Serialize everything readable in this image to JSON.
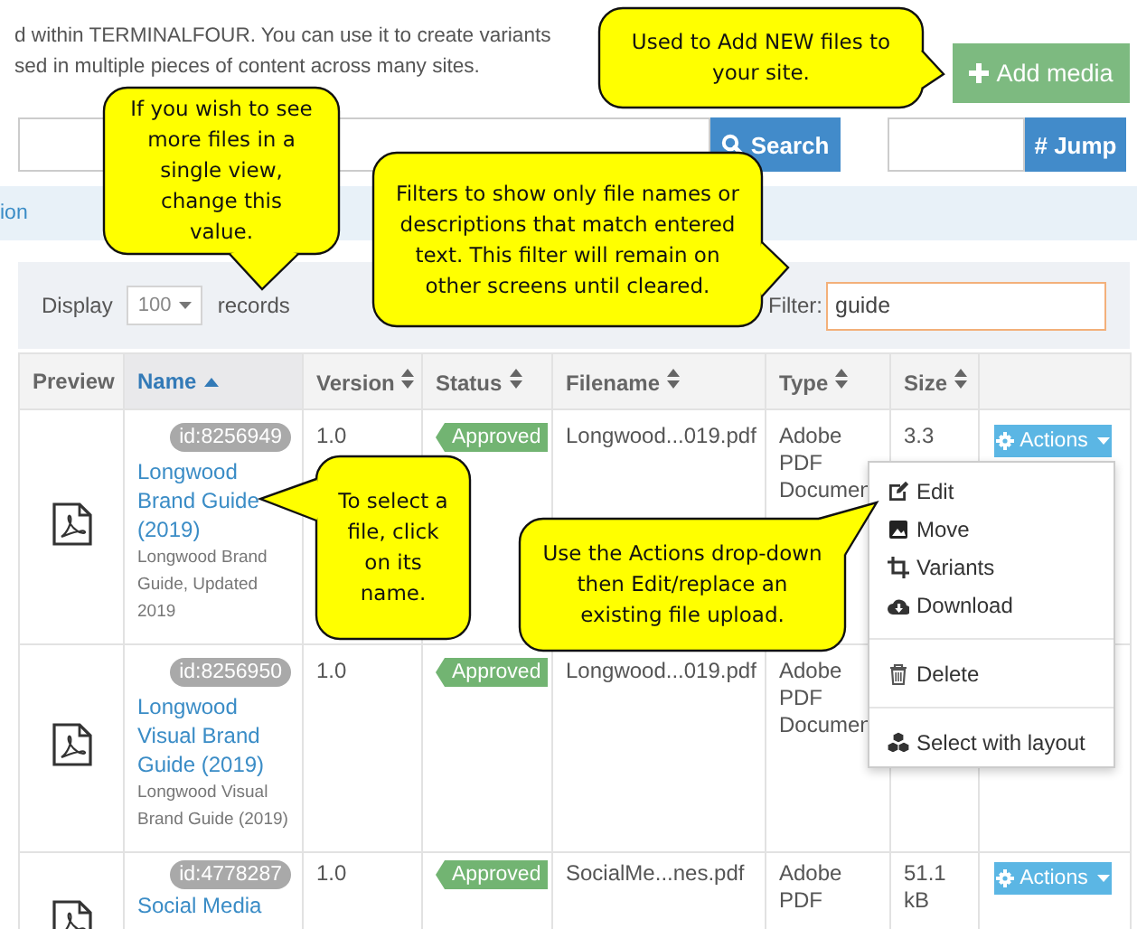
{
  "intro_lines": [
    "d within TERMINALFOUR. You can use it to create variants",
    "sed in multiple pieces of content across many sites."
  ],
  "add_button": "Add media",
  "search": {
    "button": "Search"
  },
  "jump": {
    "button": "# Jump"
  },
  "band_link": "ion",
  "display": {
    "label": "Display",
    "value": "100",
    "suffix": "records"
  },
  "filter": {
    "label": "Filter:",
    "value": "guide"
  },
  "table": {
    "columns": [
      {
        "label": "Preview",
        "sortable": false,
        "sorted": false
      },
      {
        "label": "Name",
        "sortable": true,
        "sorted": true
      },
      {
        "label": "Version",
        "sortable": true,
        "sorted": false
      },
      {
        "label": "Status",
        "sortable": true,
        "sorted": false
      },
      {
        "label": "Filename",
        "sortable": true,
        "sorted": false
      },
      {
        "label": "Type",
        "sortable": true,
        "sorted": false
      },
      {
        "label": "Size",
        "sortable": true,
        "sorted": false
      }
    ],
    "rows": [
      {
        "id": "id:8256949",
        "name": "Longwood Brand Guide (2019)",
        "description": "Longwood Brand Guide, Updated 2019",
        "version": "1.0",
        "status": "Approved",
        "filename": "Longwood...019.pdf",
        "type": "Adobe PDF Documen",
        "size": "3.3",
        "actions": "Actions"
      },
      {
        "id": "id:8256950",
        "name": "Longwood Visual Brand Guide (2019)",
        "description": "Longwood Visual Brand Guide (2019)",
        "version": "1.0",
        "status": "Approved",
        "filename": "Longwood...019.pdf",
        "type": "Adobe PDF Documen"
      },
      {
        "id": "id:4778287",
        "name": "Social Media",
        "version": "1.0",
        "status": "Approved",
        "filename": "SocialMe...nes.pdf",
        "type": "Adobe PDF",
        "size": "51.1 kB",
        "actions": "Actions"
      }
    ]
  },
  "menu": {
    "groups": [
      [
        "Edit",
        "Move",
        "Variants",
        "Download"
      ],
      [
        "Delete"
      ],
      [
        "Select with layout"
      ]
    ]
  },
  "callouts": [
    "Used to Add NEW files to your site.",
    "If you wish to see more files in a single view, change this value.",
    "Filters to show only file names or descriptions that match entered text. This filter will remain on other screens until cleared.",
    "To select a file, click on its name.",
    "Use the Actions drop-down then Edit/replace an existing file upload."
  ]
}
